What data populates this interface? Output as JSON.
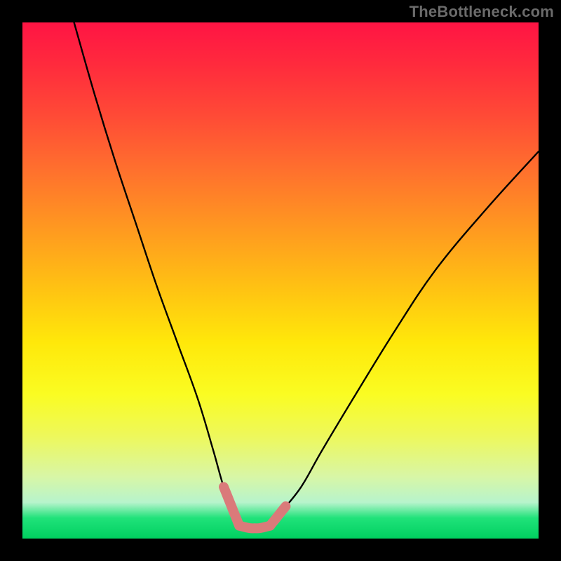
{
  "watermark": "TheBottleneck.com",
  "chart_data": {
    "type": "line",
    "title": "",
    "xlabel": "",
    "ylabel": "",
    "xlim": [
      0,
      100
    ],
    "ylim": [
      0,
      100
    ],
    "series": [
      {
        "name": "bottleneck-curve",
        "x": [
          10,
          14,
          18,
          22,
          26,
          30,
          34,
          37,
          39,
          41,
          42,
          44,
          46,
          48,
          50,
          54,
          58,
          64,
          72,
          80,
          90,
          100
        ],
        "y": [
          100,
          86,
          73,
          61,
          49,
          38,
          27,
          17,
          10,
          5,
          2.5,
          2,
          2,
          2.5,
          5,
          10,
          17,
          27,
          40,
          52,
          64,
          75
        ]
      }
    ],
    "highlight_segments": [
      {
        "name": "left-bottom-marker",
        "x_range": [
          39,
          42
        ],
        "color": "#da7a7a"
      },
      {
        "name": "right-bottom-marker",
        "x_range": [
          48,
          51
        ],
        "color": "#da7a7a"
      },
      {
        "name": "valley-floor-marker",
        "x_range": [
          42,
          48
        ],
        "color": "#da7a7a"
      }
    ],
    "background_gradient": {
      "top": "#ff1444",
      "mid": "#ffe80a",
      "bottom": "#00d060"
    }
  }
}
